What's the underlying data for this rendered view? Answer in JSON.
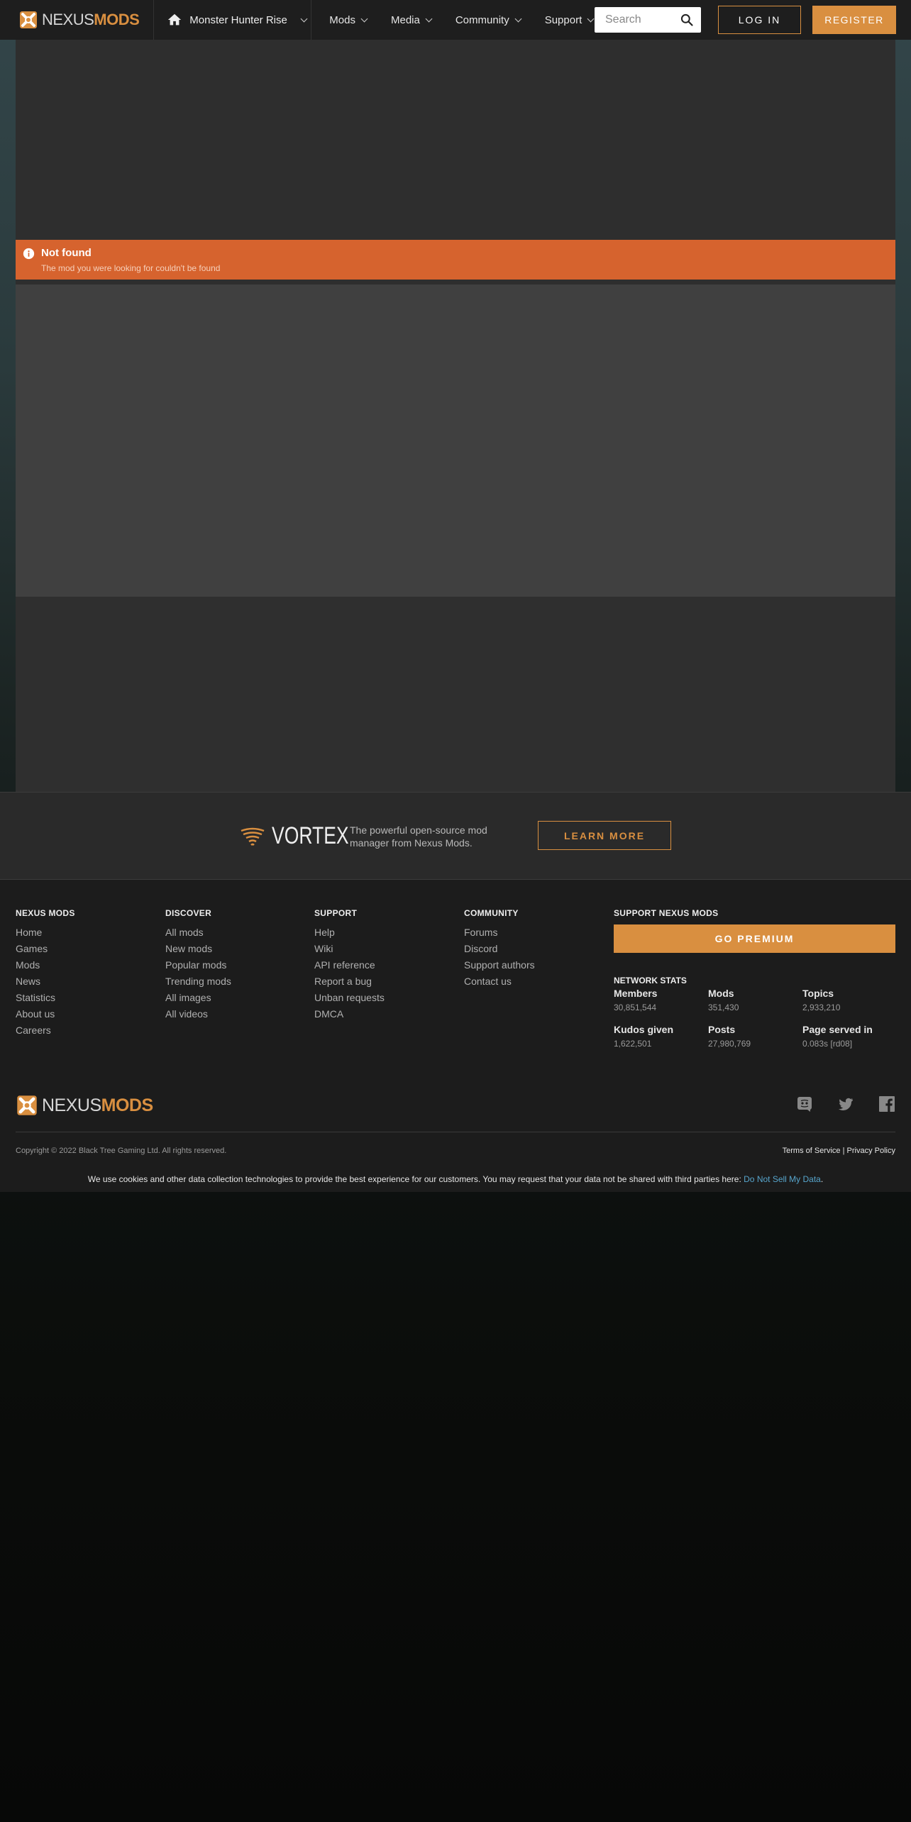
{
  "header": {
    "logo": {
      "part1": "NEXUS",
      "part2": "MODS"
    },
    "game": "Monster Hunter Rise",
    "nav": [
      {
        "label": "Mods"
      },
      {
        "label": "Media"
      },
      {
        "label": "Community"
      },
      {
        "label": "Support"
      }
    ],
    "search_placeholder": "Search",
    "login_label": "LOG IN",
    "register_label": "REGISTER"
  },
  "alert": {
    "title": "Not found",
    "message": "The mod you were looking for couldn't be found"
  },
  "vortex": {
    "name": "VORTEX",
    "tagline": "The powerful open-source mod manager from Nexus Mods.",
    "button": "LEARN MORE"
  },
  "footer": {
    "columns": [
      {
        "title": "NEXUS MODS",
        "links": [
          "Home",
          "Games",
          "Mods",
          "News",
          "Statistics",
          "About us",
          "Careers"
        ]
      },
      {
        "title": "DISCOVER",
        "links": [
          "All mods",
          "New mods",
          "Popular mods",
          "Trending mods",
          "All images",
          "All videos"
        ]
      },
      {
        "title": "SUPPORT",
        "links": [
          "Help",
          "Wiki",
          "API reference",
          "Report a bug",
          "Unban requests",
          "DMCA"
        ]
      },
      {
        "title": "COMMUNITY",
        "links": [
          "Forums",
          "Discord",
          "Support authors",
          "Contact us"
        ]
      }
    ],
    "support_title": "SUPPORT NEXUS MODS",
    "premium_button": "GO PREMIUM",
    "stats_title": "NETWORK STATS",
    "stats": [
      {
        "label": "Members",
        "value": "30,851,544"
      },
      {
        "label": "Mods",
        "value": "351,430"
      },
      {
        "label": "Topics",
        "value": "2,933,210"
      },
      {
        "label": "Kudos given",
        "value": "1,622,501"
      },
      {
        "label": "Posts",
        "value": "27,980,769"
      },
      {
        "label": "Page served in",
        "value": "0.083s [rd08]"
      }
    ],
    "copyright": "Copyright © 2022 Black Tree Gaming Ltd. All rights reserved.",
    "terms": "Terms of Service",
    "privacy": "Privacy Policy",
    "cookie_text": "We use cookies and other data collection technologies to provide the best experience for our customers. You may request that your data not be shared with third parties here:",
    "cookie_link": "Do Not Sell My Data",
    "social_icons": [
      "discord-icon",
      "twitter-icon",
      "facebook-icon"
    ]
  },
  "colors": {
    "accent": "#d98f40",
    "alert": "#d6632e",
    "link": "#57a5cc"
  }
}
